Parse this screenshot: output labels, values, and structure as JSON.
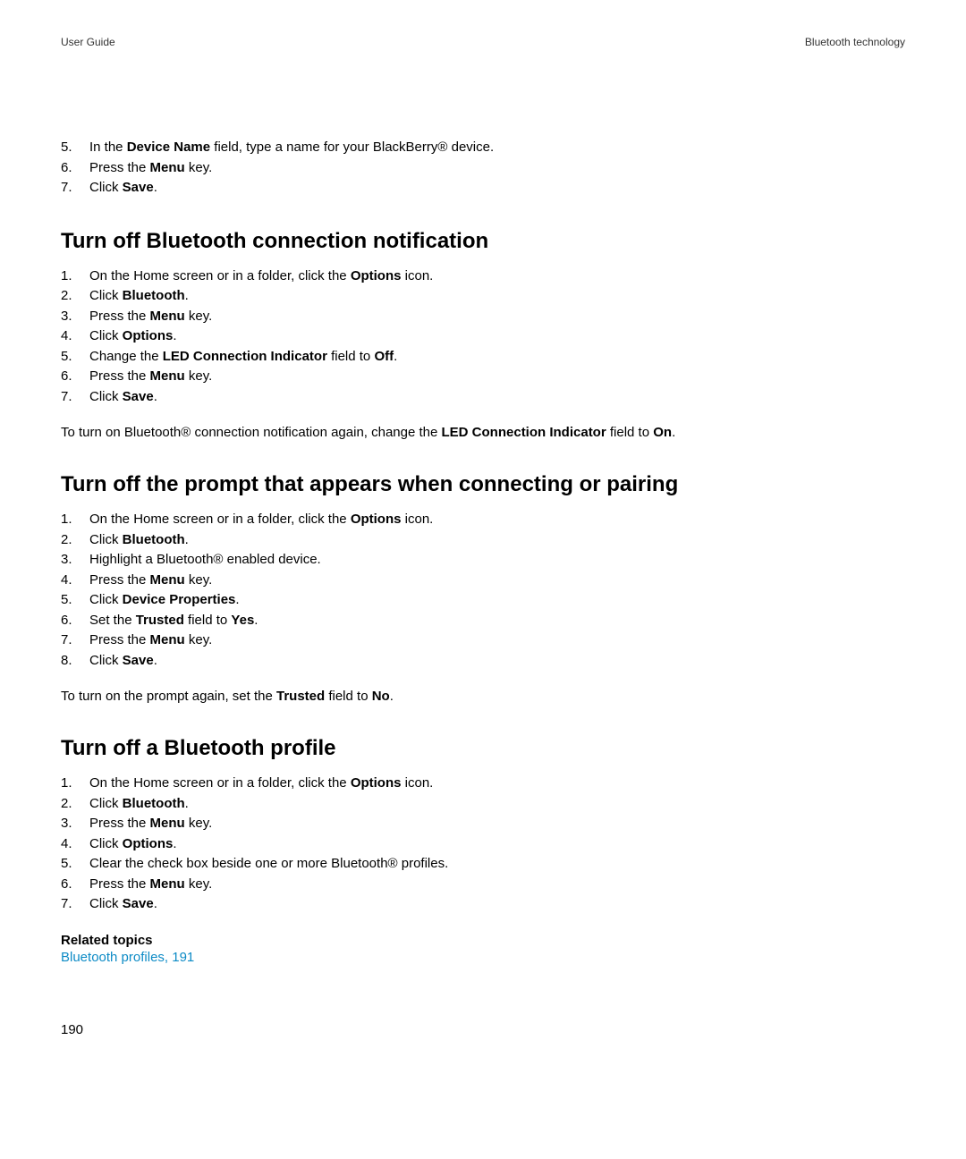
{
  "header": {
    "left": "User Guide",
    "right": "Bluetooth technology"
  },
  "topList": {
    "item5": {
      "num": "5.",
      "pre": "In the ",
      "b1": "Device Name",
      "post": " field, type a name for your BlackBerry® device."
    },
    "item6": {
      "num": "6.",
      "pre": "Press the ",
      "b1": "Menu",
      "post": " key."
    },
    "item7": {
      "num": "7.",
      "pre": "Click ",
      "b1": "Save",
      "post": "."
    }
  },
  "section1": {
    "title": "Turn off Bluetooth connection notification",
    "items": {
      "i1": {
        "num": "1.",
        "pre": "On the Home screen or in a folder, click the ",
        "b1": "Options",
        "post": " icon."
      },
      "i2": {
        "num": "2.",
        "pre": "Click ",
        "b1": "Bluetooth",
        "post": "."
      },
      "i3": {
        "num": "3.",
        "pre": "Press the ",
        "b1": "Menu",
        "post": " key."
      },
      "i4": {
        "num": "4.",
        "pre": "Click ",
        "b1": "Options",
        "post": "."
      },
      "i5": {
        "num": "5.",
        "pre": "Change the ",
        "b1": "LED Connection Indicator",
        "mid": " field to ",
        "b2": "Off",
        "post": "."
      },
      "i6": {
        "num": "6.",
        "pre": "Press the ",
        "b1": "Menu",
        "post": " key."
      },
      "i7": {
        "num": "7.",
        "pre": "Click ",
        "b1": "Save",
        "post": "."
      }
    },
    "note": {
      "pre": "To turn on Bluetooth® connection notification again, change the ",
      "b1": "LED Connection Indicator",
      "mid": " field to ",
      "b2": "On",
      "post": "."
    }
  },
  "section2": {
    "title": "Turn off the prompt that appears when connecting or pairing",
    "items": {
      "i1": {
        "num": "1.",
        "pre": "On the Home screen or in a folder, click the ",
        "b1": "Options",
        "post": " icon."
      },
      "i2": {
        "num": "2.",
        "pre": "Click ",
        "b1": "Bluetooth",
        "post": "."
      },
      "i3": {
        "num": "3.",
        "pre": "Highlight a Bluetooth® enabled device."
      },
      "i4": {
        "num": "4.",
        "pre": "Press the ",
        "b1": "Menu",
        "post": " key."
      },
      "i5": {
        "num": "5.",
        "pre": "Click ",
        "b1": "Device Properties",
        "post": "."
      },
      "i6": {
        "num": "6.",
        "pre": "Set the ",
        "b1": "Trusted",
        "mid": " field to ",
        "b2": "Yes",
        "post": "."
      },
      "i7": {
        "num": "7.",
        "pre": "Press the ",
        "b1": "Menu",
        "post": " key."
      },
      "i8": {
        "num": "8.",
        "pre": "Click ",
        "b1": "Save",
        "post": "."
      }
    },
    "note": {
      "pre": "To turn on the prompt again, set the ",
      "b1": "Trusted",
      "mid": " field to ",
      "b2": "No",
      "post": "."
    }
  },
  "section3": {
    "title": "Turn off a Bluetooth profile",
    "items": {
      "i1": {
        "num": "1.",
        "pre": "On the Home screen or in a folder, click the ",
        "b1": "Options",
        "post": " icon."
      },
      "i2": {
        "num": "2.",
        "pre": "Click ",
        "b1": "Bluetooth",
        "post": "."
      },
      "i3": {
        "num": "3.",
        "pre": "Press the ",
        "b1": "Menu",
        "post": " key."
      },
      "i4": {
        "num": "4.",
        "pre": "Click ",
        "b1": "Options",
        "post": "."
      },
      "i5": {
        "num": "5.",
        "pre": "Clear the check box beside one or more Bluetooth® profiles."
      },
      "i6": {
        "num": "6.",
        "pre": "Press the ",
        "b1": "Menu",
        "post": " key."
      },
      "i7": {
        "num": "7.",
        "pre": "Click ",
        "b1": "Save",
        "post": "."
      }
    },
    "related": {
      "heading": "Related topics",
      "link": "Bluetooth profiles, 191"
    }
  },
  "pageNumber": "190"
}
